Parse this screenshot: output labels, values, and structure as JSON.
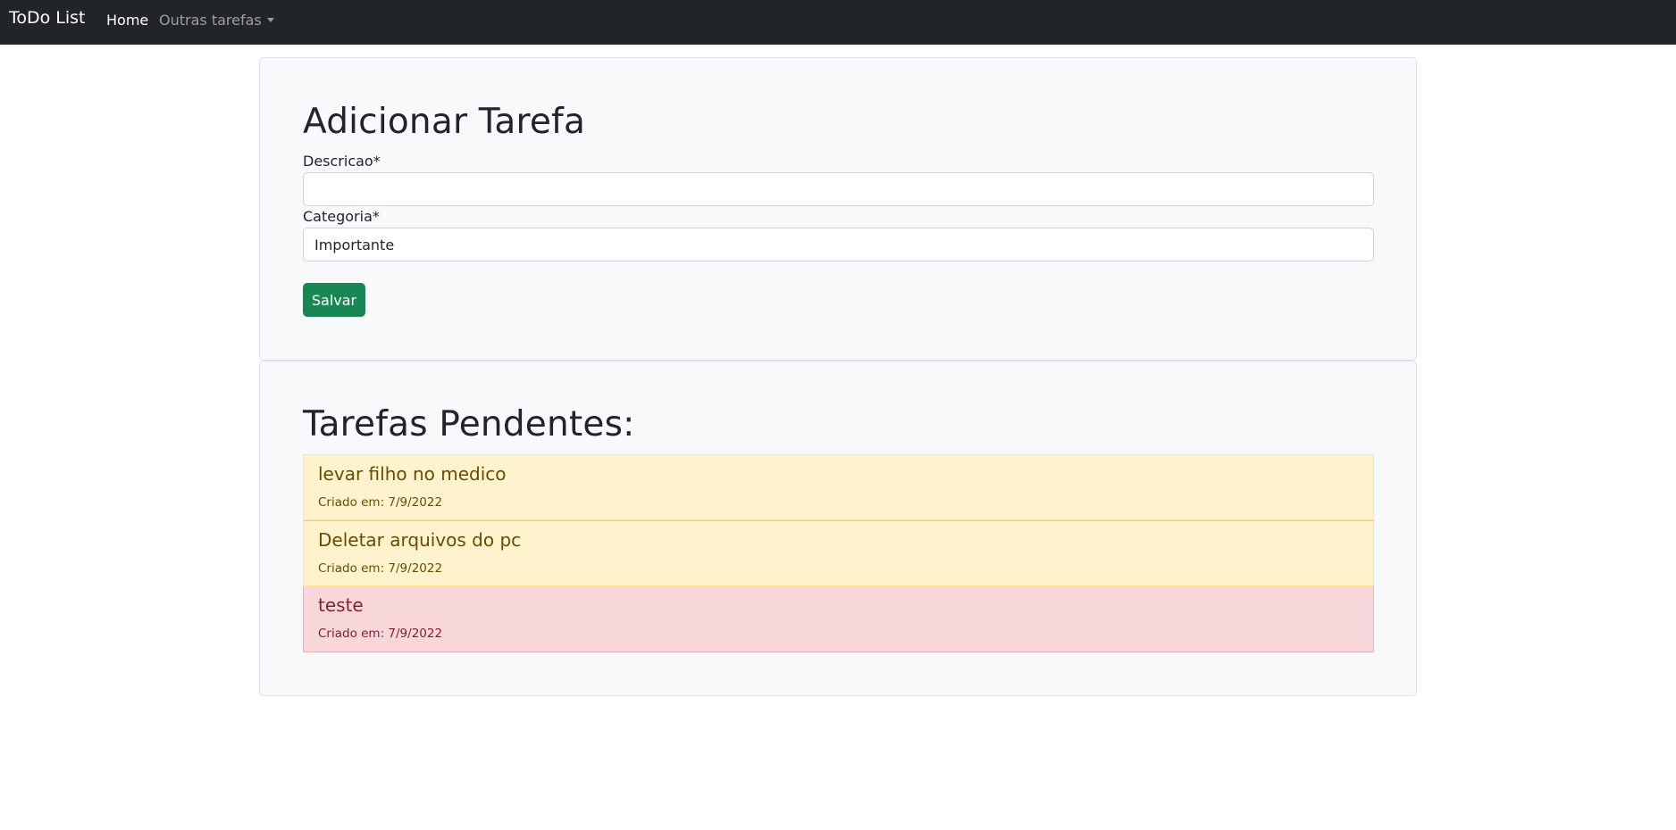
{
  "navbar": {
    "brand": "ToDo List",
    "home": "Home",
    "dropdown": "Outras tarefas"
  },
  "form": {
    "title": "Adicionar Tarefa",
    "descricao_label": "Descricao*",
    "descricao_value": "",
    "categoria_label": "Categoria*",
    "categoria_value": "Importante",
    "save_label": "Salvar"
  },
  "list": {
    "title": "Tarefas Pendentes:",
    "tasks": [
      {
        "title": "levar filho no medico",
        "date": "Criado em: 7/9/2022",
        "variant": "warning"
      },
      {
        "title": "Deletar arquivos do pc",
        "date": "Criado em: 7/9/2022",
        "variant": "warning"
      },
      {
        "title": "teste",
        "date": "Criado em: 7/9/2022",
        "variant": "danger"
      }
    ]
  },
  "colors": {
    "navbar_bg": "#212529",
    "save_button": "#198754",
    "warning_bg": "#fff3cd",
    "danger_bg": "#f8d7da"
  }
}
